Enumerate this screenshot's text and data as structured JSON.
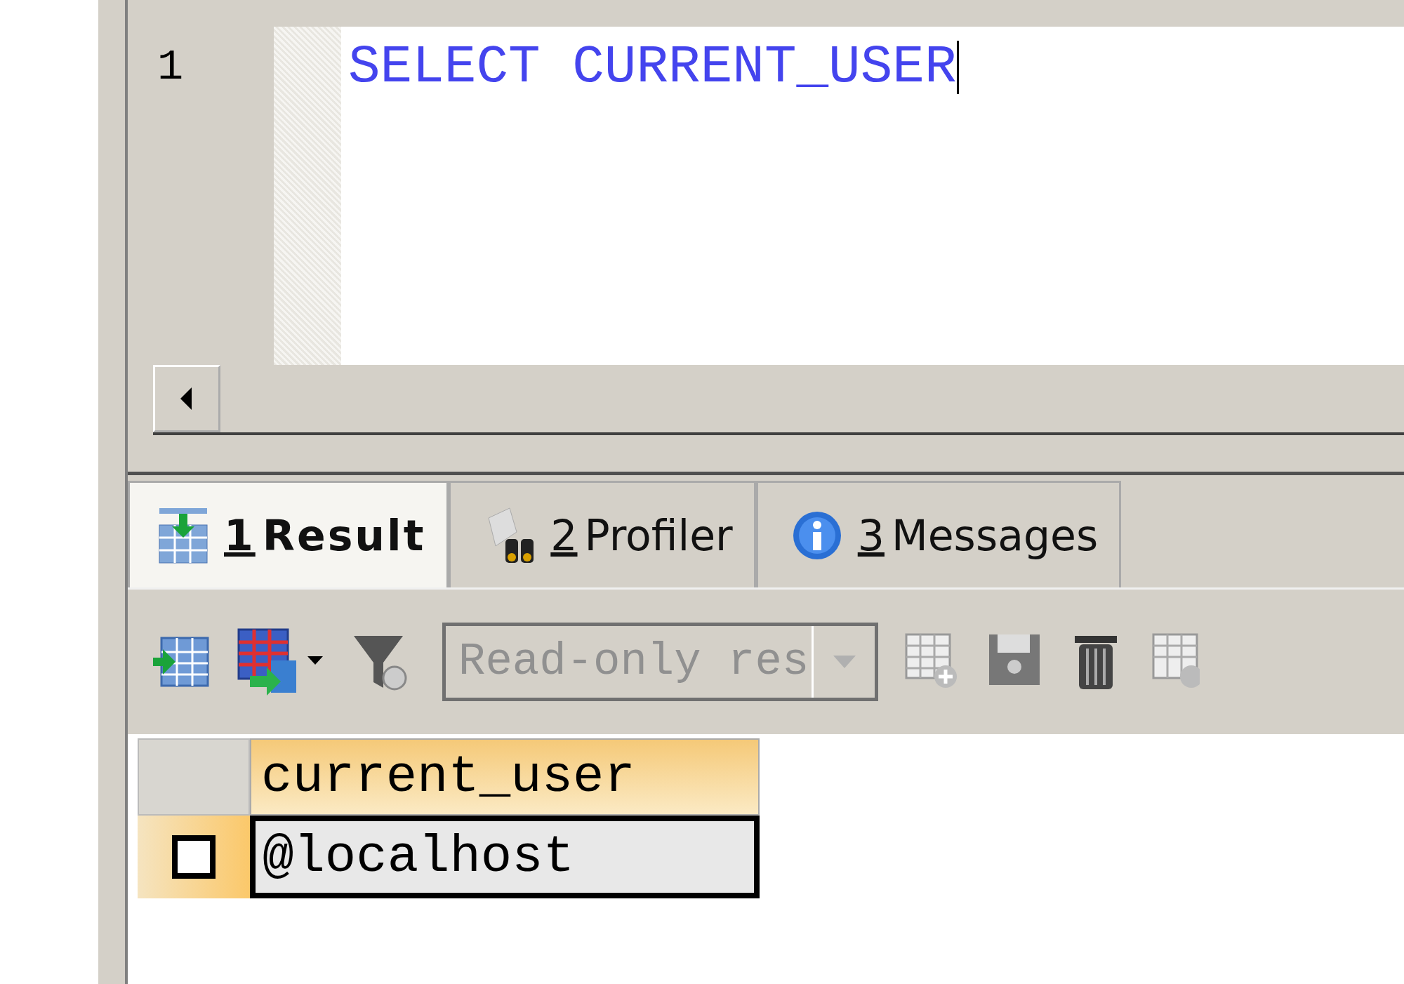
{
  "editor": {
    "line_numbers": [
      "1"
    ],
    "code": "SELECT CURRENT_USER"
  },
  "tabs": [
    {
      "number": "1",
      "label": "Result",
      "selected": true
    },
    {
      "number": "2",
      "label": "Profiler",
      "selected": false
    },
    {
      "number": "3",
      "label": "Messages",
      "selected": false
    }
  ],
  "toolbar": {
    "mode_select": "Read-only res"
  },
  "grid": {
    "columns": [
      "current_user"
    ],
    "rows": [
      {
        "cells": [
          "@localhost"
        ],
        "selected": true
      }
    ]
  }
}
